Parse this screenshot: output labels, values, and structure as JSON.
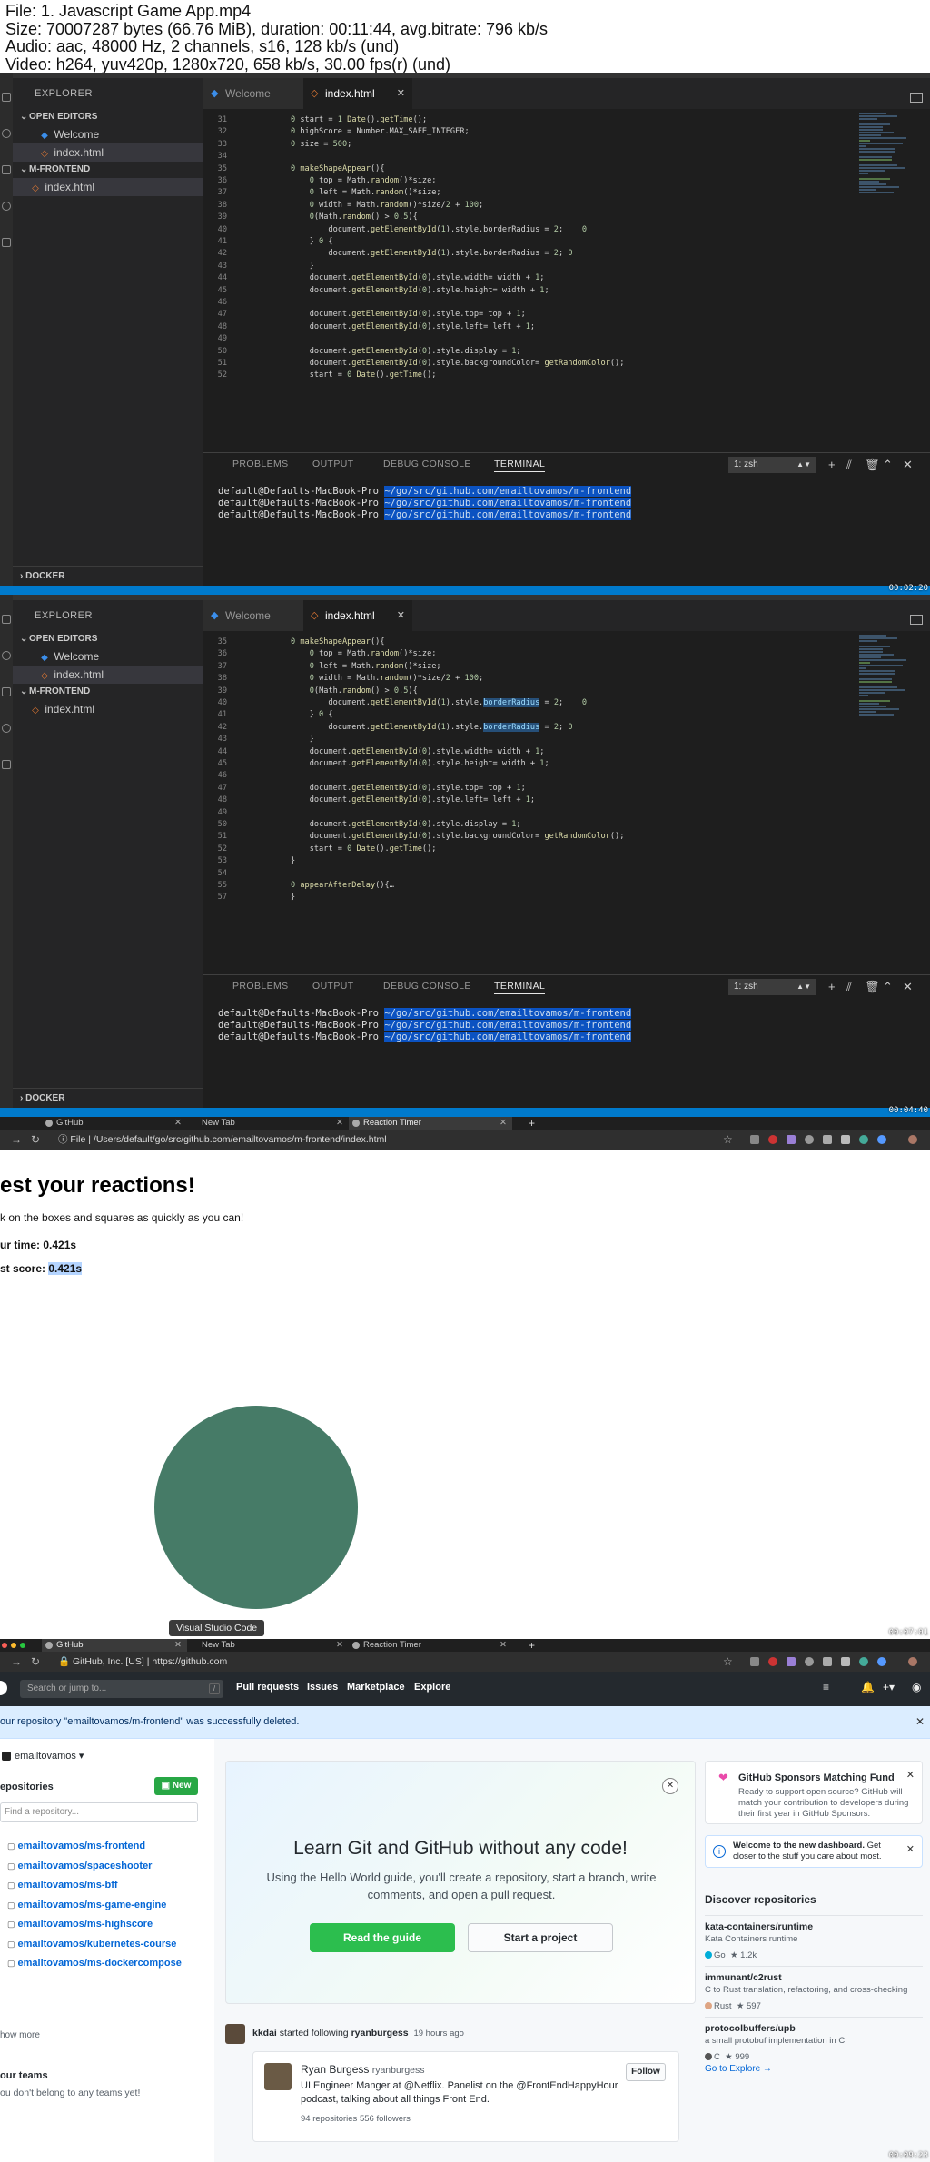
{
  "info": {
    "line1": "File: 1. Javascript Game App.mp4",
    "line2": "Size: 70007287 bytes (66.76 MiB), duration: 00:11:44, avg.bitrate: 796 kb/s",
    "line3": "Audio: aac, 48000 Hz, 2 channels, s16, 128 kb/s (und)",
    "line4": "Video: h264, yuv420p, 1280x720, 658 kb/s, 30.00 fps(r) (und)"
  },
  "vscode": {
    "explorer_title": "EXPLORER",
    "open_editors": "OPEN EDITORS",
    "open_files": [
      "Welcome",
      "index.html"
    ],
    "project": "M-FRONTEND",
    "project_file": "index.html",
    "docker": "DOCKER",
    "tab_welcome": "Welcome",
    "tab_index": "index.html",
    "panel_tabs": [
      "PROBLEMS",
      "OUTPUT",
      "DEBUG CONSOLE",
      "TERMINAL"
    ],
    "shell": "1: zsh",
    "prompt_user": "default@Defaults-MacBook-Pro",
    "prompt_path": "~/go/src/github.com/emailtovamos/m-frontend",
    "frame1": {
      "lines": [
        {
          "n": "31",
          "code": "var start = new Date().getTime();"
        },
        {
          "n": "32",
          "code": "var highScore = Number.MAX_SAFE_INTEGER;"
        },
        {
          "n": "33",
          "code": "var size = 500;"
        },
        {
          "n": "34",
          "code": ""
        },
        {
          "n": "35",
          "code": "function makeShapeAppear(){"
        },
        {
          "n": "36",
          "code": "    var top = Math.random()*size;"
        },
        {
          "n": "37",
          "code": "    var left = Math.random()*size;"
        },
        {
          "n": "38",
          "code": "    var width = Math.random()*size/2 + 100;"
        },
        {
          "n": "39",
          "code": "    if(Math.random() > 0.5){"
        },
        {
          "n": "40",
          "code": "        document.getElementById(\"shape\").style.borderRadius = \"50%\";    // Circle"
        },
        {
          "n": "41",
          "code": "    } else {"
        },
        {
          "n": "42",
          "code": "        document.getElementById(\"shape\").style.borderRadius = \"0\"; // Square"
        },
        {
          "n": "43",
          "code": "    }"
        },
        {
          "n": "44",
          "code": "    document.getElementById(\"shape\").style.width= width + \"px\";"
        },
        {
          "n": "45",
          "code": "    document.getElementById(\"shape\").style.height= width + \"px\";"
        },
        {
          "n": "46",
          "code": ""
        },
        {
          "n": "47",
          "code": "    document.getElementById(\"shape\").style.top= top + \"px\";"
        },
        {
          "n": "48",
          "code": "    document.getElementById(\"shape\").style.left= left + \"px\";"
        },
        {
          "n": "49",
          "code": ""
        },
        {
          "n": "50",
          "code": "    document.getElementById(\"shape\").style.display = \"block\";"
        },
        {
          "n": "51",
          "code": "    document.getElementById(\"shape\").style.backgroundColor= getRandomColor();"
        },
        {
          "n": "52",
          "code": "    start = new Date().getTime();"
        }
      ]
    },
    "frame2": {
      "lines": [
        {
          "n": "35",
          "code": "function makeShapeAppear(){"
        },
        {
          "n": "36",
          "code": "    var top = Math.random()*size;"
        },
        {
          "n": "37",
          "code": "    var left = Math.random()*size;"
        },
        {
          "n": "38",
          "code": "    var width = Math.random()*size/2 + 100;"
        },
        {
          "n": "39",
          "code": "    if(Math.random() > 0.5){"
        },
        {
          "n": "40",
          "code": "        document.getElementById(\"shape\").style.borderRadius = \"50%\";    // Circle"
        },
        {
          "n": "41",
          "code": "    } else {"
        },
        {
          "n": "42",
          "code": "        document.getElementById(\"shape\").style.borderRadius = \"0\"; // Square"
        },
        {
          "n": "43",
          "code": "    }"
        },
        {
          "n": "44",
          "code": "    document.getElementById(\"shape\").style.width= width + \"px\";"
        },
        {
          "n": "45",
          "code": "    document.getElementById(\"shape\").style.height= width + \"px\";"
        },
        {
          "n": "46",
          "code": ""
        },
        {
          "n": "47",
          "code": "    document.getElementById(\"shape\").style.top= top + \"px\";"
        },
        {
          "n": "48",
          "code": "    document.getElementById(\"shape\").style.left= left + \"px\";"
        },
        {
          "n": "49",
          "code": ""
        },
        {
          "n": "50",
          "code": "    document.getElementById(\"shape\").style.display = \"block\";"
        },
        {
          "n": "51",
          "code": "    document.getElementById(\"shape\").style.backgroundColor= getRandomColor();"
        },
        {
          "n": "52",
          "code": "    start = new Date().getTime();"
        },
        {
          "n": "53",
          "code": "}"
        },
        {
          "n": "54",
          "code": ""
        },
        {
          "n": "55",
          "code": "function appearAfterDelay(){…"
        },
        {
          "n": "57",
          "code": "}"
        }
      ]
    }
  },
  "stamps": [
    "00:02:20",
    "00:04:40",
    "00:07:01",
    "00:09:23"
  ],
  "chrome_game": {
    "tabs": [
      "GitHub",
      "New Tab",
      "Reaction Timer"
    ],
    "url_label": "File",
    "url": "/Users/default/go/src/github.com/emailtovamos/m-frontend/index.html"
  },
  "game": {
    "title": "est your reactions!",
    "instructions": "k on the boxes and squares as quickly as you can!",
    "time_label": "ur time: ",
    "time_value": "0.421s",
    "best_label": "st score: ",
    "best_value": "0.421s",
    "shape_color": "#467b67",
    "tooltip": "Visual Studio Code"
  },
  "chrome_gh": {
    "tabs": [
      "GitHub",
      "New Tab",
      "Reaction Timer"
    ],
    "secure": "GitHub, Inc. [US]",
    "url": "https://github.com"
  },
  "github": {
    "search_placeholder": "Search or jump to...",
    "slash": "/",
    "nav": [
      "Pull requests",
      "Issues",
      "Marketplace",
      "Explore"
    ],
    "flash": "our repository \"emailtovamos/m-frontend\" was successfully deleted.",
    "username": "emailtovamos",
    "repos_header": "epositories",
    "new_button": "New",
    "find_placeholder": "Find a repository...",
    "repos": [
      "emailtovamos/ms-frontend",
      "emailtovamos/spaceshooter",
      "emailtovamos/ms-bff",
      "emailtovamos/ms-game-engine",
      "emailtovamos/ms-highscore",
      "emailtovamos/kubernetes-course",
      "emailtovamos/ms-dockercompose"
    ],
    "show_more": "how more",
    "teams_header": "our teams",
    "teams_text": "ou don't belong to any teams yet!",
    "hero_title": "Learn Git and GitHub without any code!",
    "hero_text": "Using the Hello World guide, you'll create a repository, start a branch, write comments, and open a pull request.",
    "read_guide": "Read the guide",
    "start_project": "Start a project",
    "feed_actor": "kkdai",
    "feed_action": " started following ",
    "feed_target": "ryanburgess",
    "feed_time": "19 hours ago",
    "card_name": "Ryan Burgess",
    "card_login": "ryanburgess",
    "card_bio": "UI Engineer Manger at @Netflix. Panelist on the @FrontEndHappyHour podcast, talking about all things Front End.",
    "card_stats": "94 repositories    556 followers",
    "follow": "Follow",
    "sponsors_title": "GitHub Sponsors Matching Fund",
    "sponsors_text": "Ready to support open source? GitHub will match your contribution to developers during their first year in GitHub Sponsors.",
    "welcome_bold": "Welcome to the new dashboard.",
    "welcome_rest": " Get closer to the stuff you care about most.",
    "discover_header": "Discover repositories",
    "discover": [
      {
        "name": "kata-containers/runtime",
        "desc": "Kata Containers runtime",
        "lang": "Go",
        "lang_color": "#00add8",
        "stars": "1.2k"
      },
      {
        "name": "immunant/c2rust",
        "desc": "C to Rust translation, refactoring, and cross-checking",
        "lang": "Rust",
        "lang_color": "#dea584",
        "stars": "597"
      },
      {
        "name": "protocolbuffers/upb",
        "desc": "a small protobuf implementation in C",
        "lang": "C",
        "lang_color": "#555555",
        "stars": "999"
      }
    ],
    "go_explore": "Go to Explore →"
  }
}
